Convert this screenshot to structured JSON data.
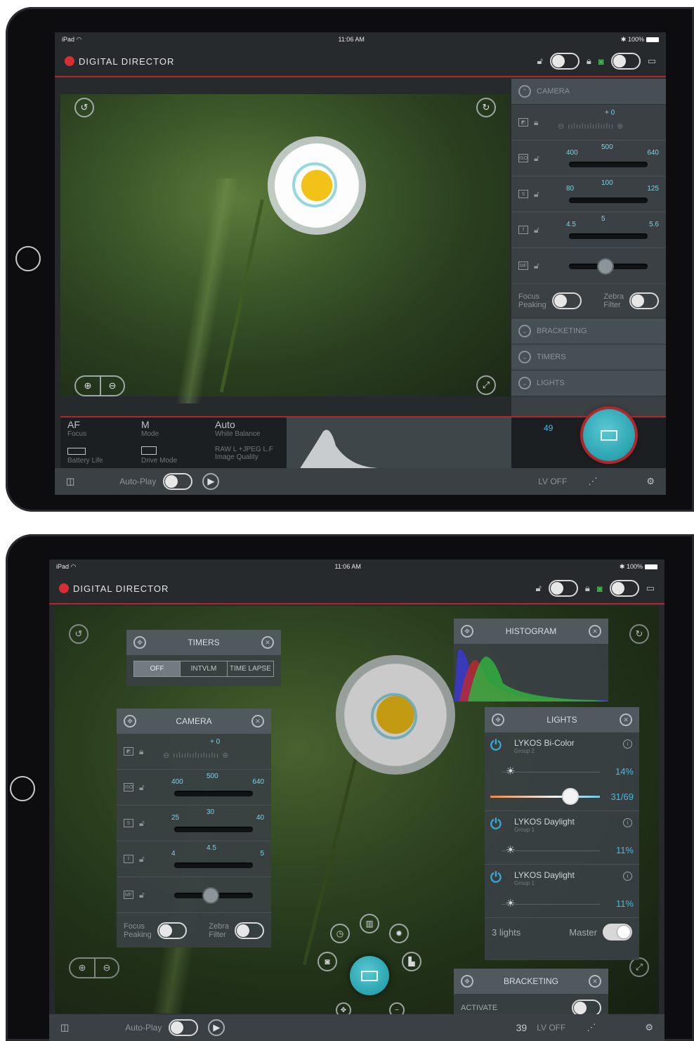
{
  "status": {
    "device": "iPad",
    "wifi": "wifi",
    "time": "11:06 AM",
    "bluetooth": "bluetooth",
    "battery": "100%"
  },
  "app": {
    "title": "DIGITAL DIRECTOR",
    "brand_color": "#d52f33",
    "accent": "#2aa3b0"
  },
  "screen1": {
    "side_sections": {
      "camera": "CAMERA",
      "bracketing": "BRACKETING",
      "timers": "TIMERS",
      "lights": "LIGHTS"
    },
    "exposure": {
      "value": "+ 0"
    },
    "iso": {
      "low": "400",
      "mid": "500",
      "high": "640"
    },
    "shutter": {
      "low": "80",
      "mid": "100",
      "high": "125"
    },
    "aperture": {
      "low": "4.5",
      "mid": "5",
      "high": "5.6"
    },
    "focus_peaking": "Focus\nPeaking",
    "zebra_filter": "Zebra\nFilter",
    "info": {
      "af": "AF",
      "af_label": "Focus",
      "mode": "M",
      "mode_label": "Mode",
      "wb": "Auto",
      "wb_label": "White Balance",
      "battery_label": "Battery Life",
      "drive_label": "Drive Mode",
      "quality": "RAW L +JPEG L.F",
      "quality_label": "Image Quality"
    },
    "shots_remaining": "49",
    "toolbar": {
      "autoplay": "Auto-Play",
      "lv": "LV OFF"
    }
  },
  "screen2": {
    "timers": {
      "title": "TIMERS",
      "options": [
        "OFF",
        "INTVLM",
        "TIME LAPSE"
      ],
      "selected": "OFF"
    },
    "camera": {
      "title": "CAMERA",
      "exposure": "+ 0",
      "iso": {
        "low": "400",
        "mid": "500",
        "high": "640"
      },
      "shutter": {
        "low": "25",
        "mid": "30",
        "high": "40"
      },
      "aperture": {
        "low": "4",
        "mid": "4.5",
        "high": "5"
      },
      "focus_peaking": "Focus\nPeaking",
      "zebra_filter": "Zebra\nFilter"
    },
    "histogram": {
      "title": "HISTOGRAM"
    },
    "lights": {
      "title": "LIGHTS",
      "items": [
        {
          "name": "LYKOS Bi-Color",
          "group": "Group 2",
          "brightness": "14%",
          "temp": "31/69"
        },
        {
          "name": "LYKOS Daylight",
          "group": "Group 1",
          "brightness": "11%"
        },
        {
          "name": "LYKOS Daylight",
          "group": "Group 1",
          "brightness": "11%"
        }
      ],
      "count": "3 lights",
      "master": "Master"
    },
    "bracketing": {
      "title": "BRACKETING",
      "activate": "ACTIVATE"
    },
    "toolbar": {
      "autoplay": "Auto-Play",
      "shots": "39",
      "lv": "LV OFF"
    }
  }
}
